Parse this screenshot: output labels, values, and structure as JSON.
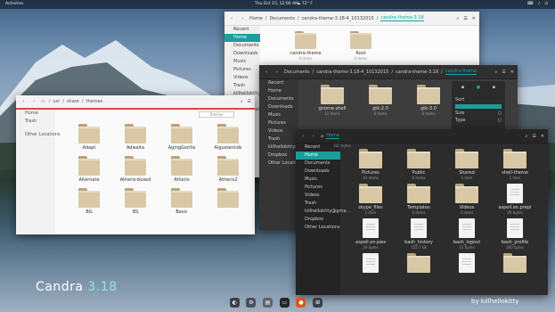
{
  "topbar": {
    "activities": "Activities",
    "clock": "Thu Oct 15, 12:00 AM",
    "indicator": "☁ 72° F",
    "tray": [
      "⌨",
      "♪",
      "⏻"
    ]
  },
  "win1": {
    "breadcrumbs": [
      "Home",
      "Documents",
      "candra-theme-3.18-4_10132015",
      "candra-theme-3.18"
    ],
    "items": [
      {
        "name": "candra-theme",
        "sub": "6 items"
      },
      {
        "name": "Root",
        "sub": "6 items"
      }
    ],
    "sidebar": [
      "Recent",
      "Home",
      "Documents",
      "Downloads",
      "Music",
      "Pictures",
      "Videos",
      "Trash",
      "killhellokitty@git...",
      "Dropbox",
      "Other Locations"
    ]
  },
  "win2": {
    "breadcrumbs": [
      "usr",
      "share",
      "themes"
    ],
    "search": "themes",
    "sidebar": [
      "Home",
      "Trash",
      "Other Locations"
    ],
    "items": [
      "Adapt",
      "Adwaita",
      "AgingGorilla",
      "Aigusteroids",
      "Alternate",
      "Atheris-boxed",
      "Atheris",
      "Atheris2",
      "BG",
      "BS",
      "Basic",
      "",
      "",
      ""
    ]
  },
  "win3": {
    "breadcrumbs": [
      "Documents",
      "candra-theme-3.18-4_10132015",
      "candra-theme-3.18",
      "candra-theme"
    ],
    "sidebar": [
      "Recent",
      "Home",
      "Documents",
      "Downloads",
      "Music",
      "Pictures",
      "Videos",
      "Trash",
      "killhellokitty@git...",
      "Dropbox",
      "Other Locations"
    ],
    "items": [
      {
        "name": "gnome-shell",
        "sub": "11 items"
      },
      {
        "name": "gtk-2.0",
        "sub": "6 items"
      },
      {
        "name": "gtk-3.0",
        "sub": "6 items"
      }
    ],
    "panel": {
      "sort": "Sort",
      "size": "Size",
      "type": "Type"
    }
  },
  "win4": {
    "breadcrumbs": [
      "Home"
    ],
    "sizehint": "382 bytes",
    "sidebar": [
      "Recent",
      "Home",
      "Documents",
      "Downloads",
      "Music",
      "Pictures",
      "Videos",
      "Trash",
      "killhellokitty@gma...",
      "Dropbox",
      "Other Locations"
    ],
    "items": [
      {
        "name": "Pictures",
        "sub": "43 items",
        "kind": "folder-img"
      },
      {
        "name": "Public",
        "sub": "0 items",
        "kind": "folder-share"
      },
      {
        "name": "Shared",
        "sub": "1 item",
        "kind": "folder"
      },
      {
        "name": "shell-theme",
        "sub": "1 item",
        "kind": "folder"
      },
      {
        "name": "skype_files",
        "sub": "1 item",
        "kind": "folder-sky"
      },
      {
        "name": "Templates",
        "sub": "0 items",
        "kind": "folder"
      },
      {
        "name": "Videos",
        "sub": "4 items",
        "kind": "folder"
      },
      {
        "name": "aspell.en.prepl",
        "sub": "29 bytes",
        "kind": "doc"
      },
      {
        "name": "aspell.en.pws",
        "sub": "29 bytes",
        "kind": "doc"
      },
      {
        "name": "bash_history",
        "sub": "152.7 kB",
        "kind": "doc"
      },
      {
        "name": "bash_logout",
        "sub": "21 bytes",
        "kind": "doc"
      },
      {
        "name": "bash_profile",
        "sub": "300 bytes",
        "kind": "doc"
      },
      {
        "name": "",
        "sub": "",
        "kind": "doc"
      },
      {
        "name": "",
        "sub": "",
        "kind": "doc"
      },
      {
        "name": "",
        "sub": "",
        "kind": "doc"
      },
      {
        "name": "",
        "sub": "",
        "kind": "doc"
      }
    ]
  },
  "dock": [
    {
      "icon": "shell-icon",
      "bg": "#3a3f46",
      "g": "◐"
    },
    {
      "icon": "settings-icon",
      "bg": "#4a5059",
      "g": "⚙"
    },
    {
      "icon": "files-icon",
      "bg": "#5c6470",
      "g": "▤"
    },
    {
      "icon": "terminal-icon",
      "bg": "#20242a",
      "g": "▭"
    },
    {
      "icon": "firefox-icon",
      "bg": "#d65a1f",
      "g": "●"
    },
    {
      "icon": "apps-grid-icon",
      "bg": "#3a3f46",
      "g": "⊞"
    }
  ],
  "brand": {
    "name": "Candra",
    "version": "3.18"
  },
  "credit": "by killhellokitty",
  "colors": {
    "accent": "#1d9c9c"
  }
}
